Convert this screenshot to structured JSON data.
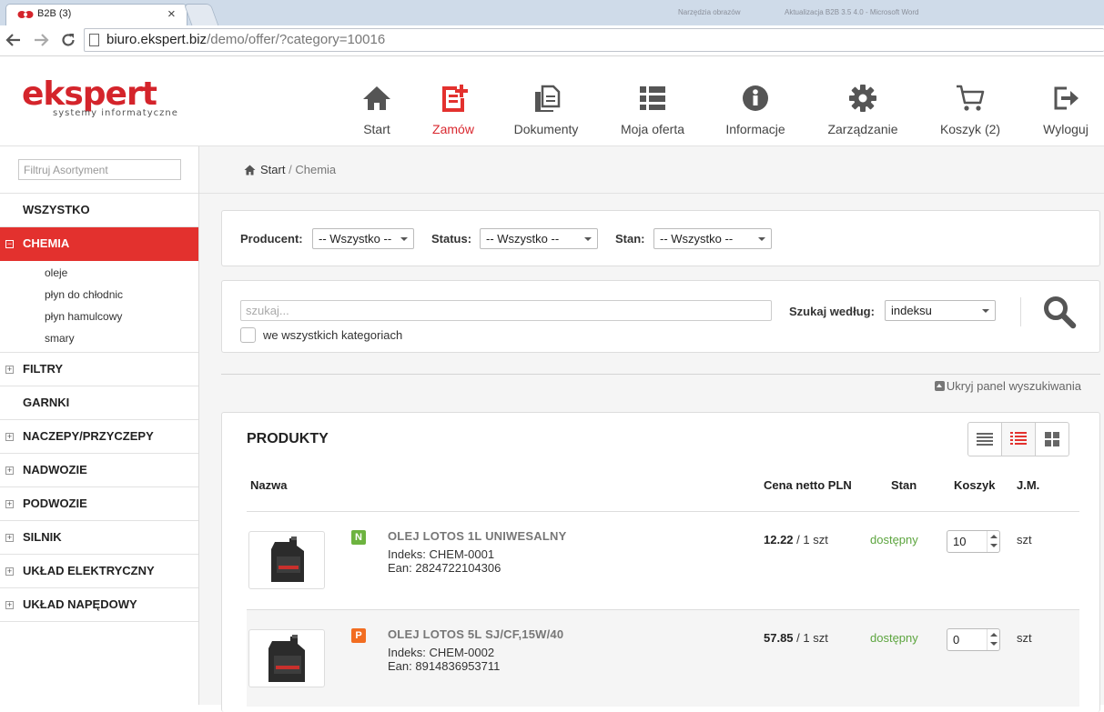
{
  "browser": {
    "tab_title": "B2B (3)",
    "tab_close": "×",
    "blurred_text": [
      "Narzędzia obrazów",
      "Aktualizacja B2B 3.5 4.0 - Microsoft Word"
    ],
    "url_host": "biuro.ekspert.biz",
    "url_path": "/demo/offer/?category=10016"
  },
  "logo": {
    "main": "ekspert",
    "sub": "systemy informatyczne"
  },
  "nav": {
    "start": "Start",
    "zamow": "Zamów",
    "dokumenty": "Dokumenty",
    "oferta": "Moja oferta",
    "informacje": "Informacje",
    "zarzadzanie": "Zarządzanie",
    "koszyk": "Koszyk (2)",
    "wyloguj": "Wyloguj"
  },
  "colors": {
    "accent": "#e3312e",
    "available": "#5da53f",
    "badge_n": "#6db33f",
    "badge_p": "#f26d21"
  },
  "sidebar": {
    "filter_placeholder": "Filtruj Asortyment",
    "categories": [
      {
        "label": "WSZYSTKO"
      },
      {
        "label": "CHEMIA",
        "sign": "−"
      },
      {
        "label": "FILTRY",
        "sign": "+"
      },
      {
        "label": "GARNKI"
      },
      {
        "label": "NACZEPY/PRZYCZEPY",
        "sign": "+"
      },
      {
        "label": "NADWOZIE",
        "sign": "+"
      },
      {
        "label": "PODWOZIE",
        "sign": "+"
      },
      {
        "label": "SILNIK",
        "sign": "+"
      },
      {
        "label": "UKŁAD ELEKTRYCZNY",
        "sign": "+"
      },
      {
        "label": "UKŁAD NAPĘDOWY",
        "sign": "+"
      }
    ],
    "subcategories": [
      "oleje",
      "płyn do chłodnic",
      "płyn hamulcowy",
      "smary"
    ]
  },
  "breadcrumb": {
    "home": "Start",
    "separator": "/",
    "current": "Chemia"
  },
  "filters": {
    "producent_label": "Producent:",
    "producent_value": "-- Wszystko --",
    "status_label": "Status:",
    "status_value": "-- Wszystko --",
    "stan_label": "Stan:",
    "stan_value": "-- Wszystko --"
  },
  "search": {
    "placeholder": "szukaj...",
    "all_categories_label": "we wszystkich kategoriach",
    "by_label": "Szukaj według:",
    "by_value": "indeksu"
  },
  "hide_panel": "Ukryj panel wyszukiwania",
  "products": {
    "title": "PRODUKTY",
    "columns": {
      "name": "Nazwa",
      "price": "Cena netto PLN",
      "stock": "Stan",
      "cart": "Koszyk",
      "unit": "J.M."
    },
    "rows": [
      {
        "badge": "N",
        "name": "OLEJ LOTOS 1L UNIWESALNY",
        "index": "Indeks: CHEM-0001",
        "ean": "Ean: 2824722104306",
        "price": "12.22",
        "per": "/ 1 szt",
        "stock": "dostępny",
        "qty": "10",
        "unit": "szt"
      },
      {
        "badge": "P",
        "name": "OLEJ LOTOS 5L SJ/CF,15W/40",
        "index": "Indeks: CHEM-0002",
        "ean": "Ean: 8914836953711",
        "price": "57.85",
        "per": "/ 1 szt",
        "stock": "dostępny",
        "qty": "0",
        "unit": "szt"
      }
    ]
  }
}
